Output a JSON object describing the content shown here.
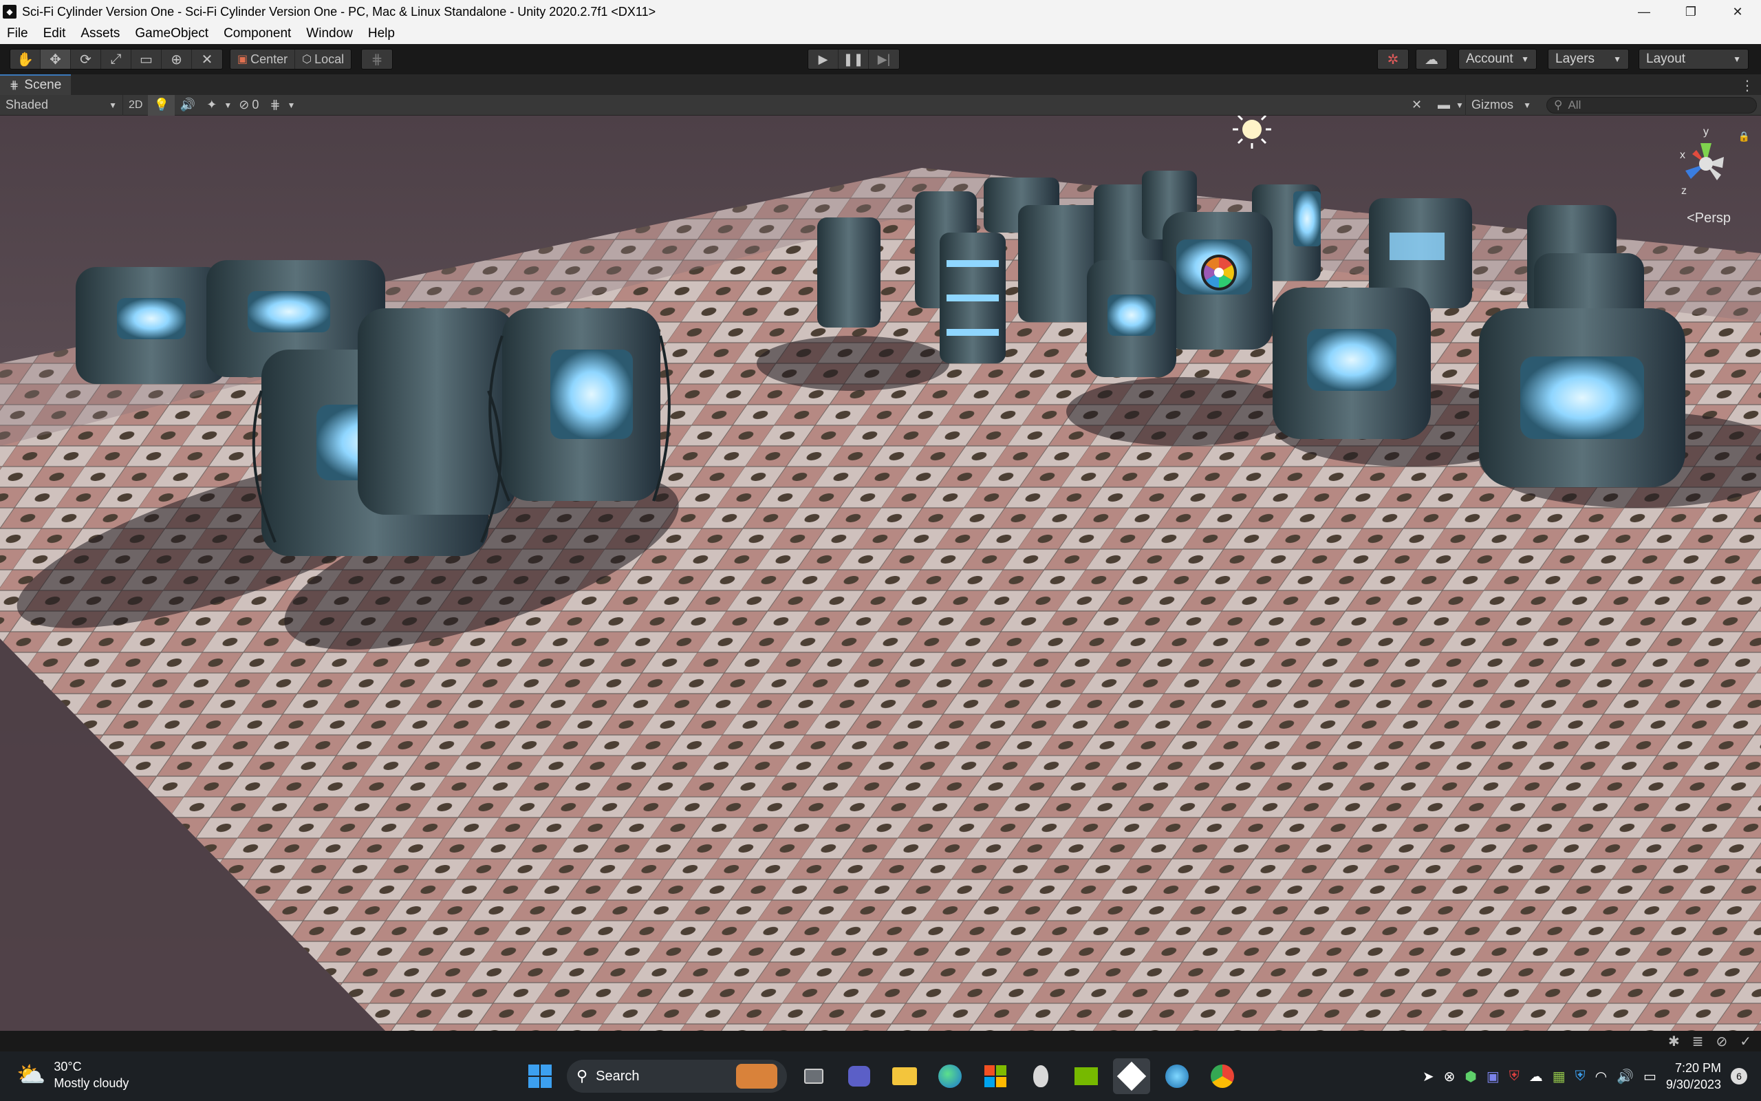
{
  "window": {
    "title": "Sci-Fi Cylinder Version One - Sci-Fi Cylinder Version One - PC, Mac & Linux Standalone - Unity 2020.2.7f1 <DX11>",
    "controls": [
      "—",
      "❐",
      "✕"
    ]
  },
  "menu": [
    "File",
    "Edit",
    "Assets",
    "GameObject",
    "Component",
    "Window",
    "Help"
  ],
  "toolbar": {
    "tools": [
      "hand-tool",
      "move-tool",
      "rotate-tool",
      "scale-tool",
      "rect-tool",
      "transform-tool",
      "custom-tool"
    ],
    "active_tool": "move-tool",
    "pivot_label": "Center",
    "space_label": "Local",
    "account_label": "Account",
    "layers_label": "Layers",
    "layout_label": "Layout"
  },
  "scene_tab": {
    "label": "Scene"
  },
  "scene_bar": {
    "draw_mode": "Shaded",
    "mode_2d": "2D",
    "hidden_count": "0",
    "gizmos_label": "Gizmos",
    "search_placeholder": "All"
  },
  "viewport": {
    "projection_label": "Persp",
    "axis_labels": {
      "x": "x",
      "y": "y",
      "z": "z"
    },
    "colors": {
      "floor_light": "#d8c8c4",
      "floor_pink": "#b98a84",
      "glow": "#9fe4ff",
      "metal": "#3e5057"
    }
  },
  "taskbar": {
    "weather_temp": "30°C",
    "weather_desc": "Mostly cloudy",
    "search_label": "Search",
    "time": "7:20 PM",
    "date": "9/30/2023",
    "notification_count": "6"
  }
}
